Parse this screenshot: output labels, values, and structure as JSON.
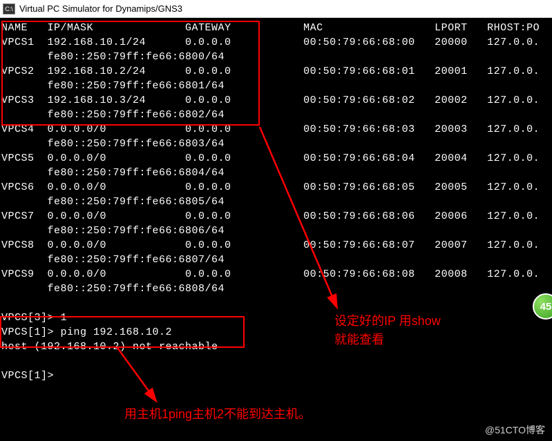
{
  "titlebar": {
    "icon_label": "C:\\",
    "title": "Virtual PC Simulator for Dynamips/GNS3"
  },
  "header": {
    "name": "NAME",
    "ipmask": "IP/MASK",
    "gateway": "GATEWAY",
    "mac": "MAC",
    "lport": "LPORT",
    "rhost": "RHOST:PO"
  },
  "vpcs": [
    {
      "name": "VPCS1",
      "ip": "192.168.10.1/24",
      "gw": "0.0.0.0",
      "mac": "00:50:79:66:68:00",
      "lport": "20000",
      "rhost": "127.0.0.",
      "ipv6": "fe80::250:79ff:fe66:6800/64"
    },
    {
      "name": "VPCS2",
      "ip": "192.168.10.2/24",
      "gw": "0.0.0.0",
      "mac": "00:50:79:66:68:01",
      "lport": "20001",
      "rhost": "127.0.0.",
      "ipv6": "fe80::250:79ff:fe66:6801/64"
    },
    {
      "name": "VPCS3",
      "ip": "192.168.10.3/24",
      "gw": "0.0.0.0",
      "mac": "00:50:79:66:68:02",
      "lport": "20002",
      "rhost": "127.0.0.",
      "ipv6": "fe80::250:79ff:fe66:6802/64"
    },
    {
      "name": "VPCS4",
      "ip": "0.0.0.0/0",
      "gw": "0.0.0.0",
      "mac": "00:50:79:66:68:03",
      "lport": "20003",
      "rhost": "127.0.0.",
      "ipv6": "fe80::250:79ff:fe66:6803/64"
    },
    {
      "name": "VPCS5",
      "ip": "0.0.0.0/0",
      "gw": "0.0.0.0",
      "mac": "00:50:79:66:68:04",
      "lport": "20004",
      "rhost": "127.0.0.",
      "ipv6": "fe80::250:79ff:fe66:6804/64"
    },
    {
      "name": "VPCS6",
      "ip": "0.0.0.0/0",
      "gw": "0.0.0.0",
      "mac": "00:50:79:66:68:05",
      "lport": "20005",
      "rhost": "127.0.0.",
      "ipv6": "fe80::250:79ff:fe66:6805/64"
    },
    {
      "name": "VPCS7",
      "ip": "0.0.0.0/0",
      "gw": "0.0.0.0",
      "mac": "00:50:79:66:68:06",
      "lport": "20006",
      "rhost": "127.0.0.",
      "ipv6": "fe80::250:79ff:fe66:6806/64"
    },
    {
      "name": "VPCS8",
      "ip": "0.0.0.0/0",
      "gw": "0.0.0.0",
      "mac": "00:50:79:66:68:07",
      "lport": "20007",
      "rhost": "127.0.0.",
      "ipv6": "fe80::250:79ff:fe66:6807/64"
    },
    {
      "name": "VPCS9",
      "ip": "0.0.0.0/0",
      "gw": "0.0.0.0",
      "mac": "00:50:79:66:68:08",
      "lport": "20008",
      "rhost": "127.0.0.",
      "ipv6": "fe80::250:79ff:fe66:6808/64"
    }
  ],
  "prompts": {
    "line1": "VPCS[3]> 1",
    "line2": "VPCS[1]> ping 192.168.10.2",
    "line3": "host (192.168.10.2) not reachable",
    "line4": "VPCS[1]>"
  },
  "annotations": {
    "right": "设定好的IP 用show\n就能查看",
    "bottom": "用主机1ping主机2不能到达主机。"
  },
  "badge": {
    "value": "45"
  },
  "watermark": "@51CTO博客"
}
